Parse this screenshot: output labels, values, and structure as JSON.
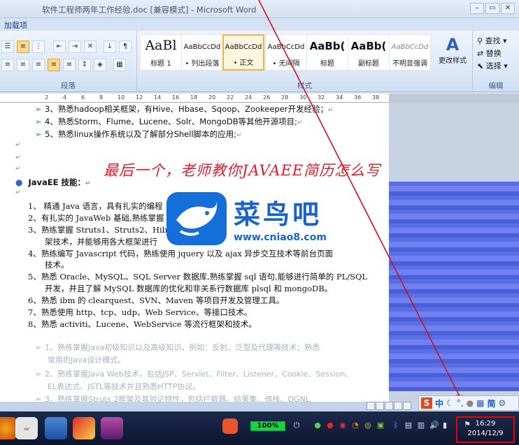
{
  "window": {
    "title": "软件工程师两年工作经验.doc [兼容模式] - Microsoft Word"
  },
  "tabs": {
    "addins": "加载项"
  },
  "ribbon": {
    "paragraph_label": "段落",
    "styles_label": "样式",
    "editing_label": "编辑",
    "styles": [
      {
        "sample": "AaBl",
        "name": "标题 1"
      },
      {
        "sample": "AaBbCcDd",
        "name": "• 列出段落"
      },
      {
        "sample": "AaBbCcDd",
        "name": "• 正文"
      },
      {
        "sample": "AaBbCcDd",
        "name": "• 无间隔"
      },
      {
        "sample": "AaBb(",
        "name": "标题"
      },
      {
        "sample": "AaBb(",
        "name": "副标题"
      },
      {
        "sample": "AaBbCcDd",
        "name": "不明显强调"
      }
    ],
    "change_styles": "更改样式",
    "find": "查找",
    "replace": "替换",
    "select": "选择"
  },
  "ruler": {
    "ticks": [
      "2",
      "4",
      "6",
      "8",
      "10",
      "12",
      "14",
      "16",
      "18",
      "20",
      "22",
      "24",
      "26",
      "28",
      "30",
      "32",
      "34",
      "36",
      "38",
      "40"
    ]
  },
  "document": {
    "lines": [
      "3、熟悉hadoop相关框架，有Hive、Hbase、Sqoop、Zookeeper开发经验；",
      "4、熟悉Storm、Flume、Lucene、Solr、MongoDB等其他开源项目;",
      "5、熟悉linux操作系统以及了解部分Shell脚本的应用;",
      "JavaEE 技能：",
      "1、 精通 Java 语言，具有扎实的编程",
      "2、有扎实的 JavaWeb 基础,熟练掌握",
      "3、熟练掌握 Struts1、Struts2、Hiber",
      "架技术，并能够用各大框架进行",
      "4、熟练编写 Javascript 代码，熟练使用 jquery 以及 ajax 异步交互技术等前台页面",
      "技术。",
      "5、熟悉 Oracle、MySQL、SQL Server 数据库,熟练掌握 sql 语句,能够进行简单的 PL/SQL",
      "开发，并且了解 MySQL 数据库的优化和非关系行数据库 plsql 和 mongoDB。",
      "6、熟悉 ibm 的 clearquest、SVN、Maven 等项目开发及管理工具。",
      "7、熟悉使用 http、tcp、udp、Web Service、等接口技术。",
      "8、熟悉 activiti、Lucene、WebService 等流行框架和技术。",
      "1、熟练掌握Java初级知识以及高级知识，例如：反射、泛型及代理等技术；熟悉",
      "常用的Java设计模式。",
      "2、熟练掌握Java Web技术，包括JSP、Servlet、Filter、Listener、Cookie、Session、",
      "EL表达式、JSTL等技术并且熟悉HTTP协议。",
      "3、熟练掌握Struts 2框架及其验证特性，包括拦截器、结果集、值栈、OGNL"
    ],
    "overlay_text": "最后一个，老师教你JAVAEE简历怎么写",
    "logo_text": "菜鸟吧",
    "logo_url": "www.cniao8.com"
  },
  "taskbar": {
    "battery": "100%",
    "time": "16:29",
    "date": "2014/12/9"
  },
  "ime": {
    "zh": "中",
    "simp": "简"
  }
}
